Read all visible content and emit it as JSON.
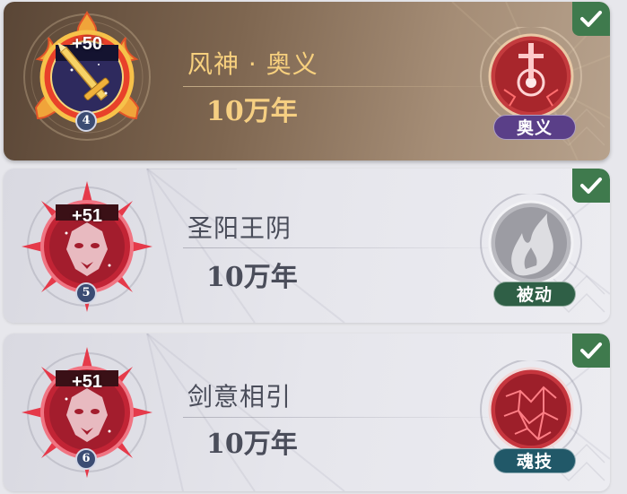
{
  "skills": [
    {
      "style": "gold",
      "bonus": "+50",
      "level": "4",
      "name": "风神 · 奥义",
      "age": "10万年",
      "type_label": "奥义",
      "type_color": "#5a3f88",
      "selected": true
    },
    {
      "style": "silver",
      "bonus": "+51",
      "level": "5",
      "name": "圣阳王阴",
      "age": "10万年",
      "type_label": "被动",
      "type_color": "#2f5f46",
      "selected": true
    },
    {
      "style": "silver",
      "bonus": "+51",
      "level": "6",
      "name": "剑意相引",
      "age": "10万年",
      "type_label": "魂技",
      "type_color": "#215868",
      "selected": true
    }
  ],
  "icons": {
    "check": "checkmark-icon",
    "gold_emblem": "golden-sword-emblem-icon",
    "red_emblem": "red-beast-emblem-icon",
    "skill_1": "red-cross-orb-icon",
    "skill_2": "grey-flame-orb-icon",
    "skill_3": "red-crystal-orb-icon"
  }
}
